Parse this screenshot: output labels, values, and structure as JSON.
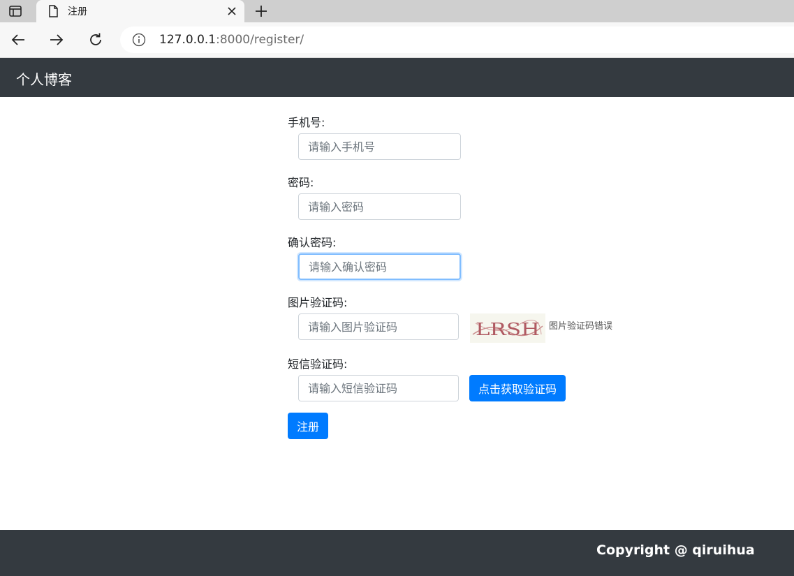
{
  "browser": {
    "tab_title": "注册",
    "url_host": "127.0.0.1",
    "url_path": ":8000/register/",
    "icons": {
      "tab_strip": "sidebar-panel-icon",
      "tab": "page-icon",
      "close": "close-icon",
      "new_tab": "plus-icon",
      "back": "arrow-left-icon",
      "forward": "arrow-right-icon",
      "reload": "reload-icon",
      "info": "info-icon"
    }
  },
  "navbar": {
    "brand": "个人博客"
  },
  "form": {
    "phone": {
      "label": "手机号:",
      "placeholder": "请输入手机号",
      "value": ""
    },
    "password": {
      "label": "密码:",
      "placeholder": "请输入密码",
      "value": ""
    },
    "confirm_password": {
      "label": "确认密码:",
      "placeholder": "请输入确认密码",
      "value": ""
    },
    "image_code": {
      "label": "图片验证码:",
      "placeholder": "请输入图片验证码",
      "value": "",
      "captcha_text": "LRSH",
      "error": "图片验证码错误"
    },
    "sms_code": {
      "label": "短信验证码:",
      "placeholder": "请输入短信验证码",
      "value": "",
      "button": "点击获取验证码"
    },
    "submit": "注册"
  },
  "footer": {
    "copyright": "Copyright @ qiruihua"
  },
  "colors": {
    "navbar": "#343a40",
    "primary": "#007bff",
    "focus_border": "#80bdff"
  }
}
